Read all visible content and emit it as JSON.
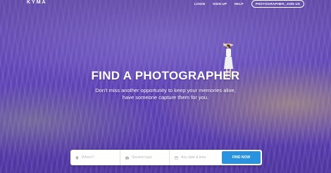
{
  "brand": {
    "logo": "KYMA"
  },
  "nav": {
    "login": "LOGIN",
    "signup": "SIGN UP",
    "help": "HELP",
    "join": "PHOTOGRAPHER, JOIN US"
  },
  "hero": {
    "title": "FIND A PHOTOGRAPHER",
    "subtitle_line1": "Don't miss another opportunity to keep your memories alive,",
    "subtitle_line2": "have someone capture them for you."
  },
  "search": {
    "where_placeholder": "Where?",
    "session_placeholder": "Session type",
    "date_placeholder": "Any date & time",
    "find_label": "FIND NOW"
  },
  "colors": {
    "accent": "#2a93e0",
    "lavender": "#6a4fb8"
  },
  "icons": [
    "location-pin-icon",
    "camera-icon",
    "calendar-icon"
  ]
}
